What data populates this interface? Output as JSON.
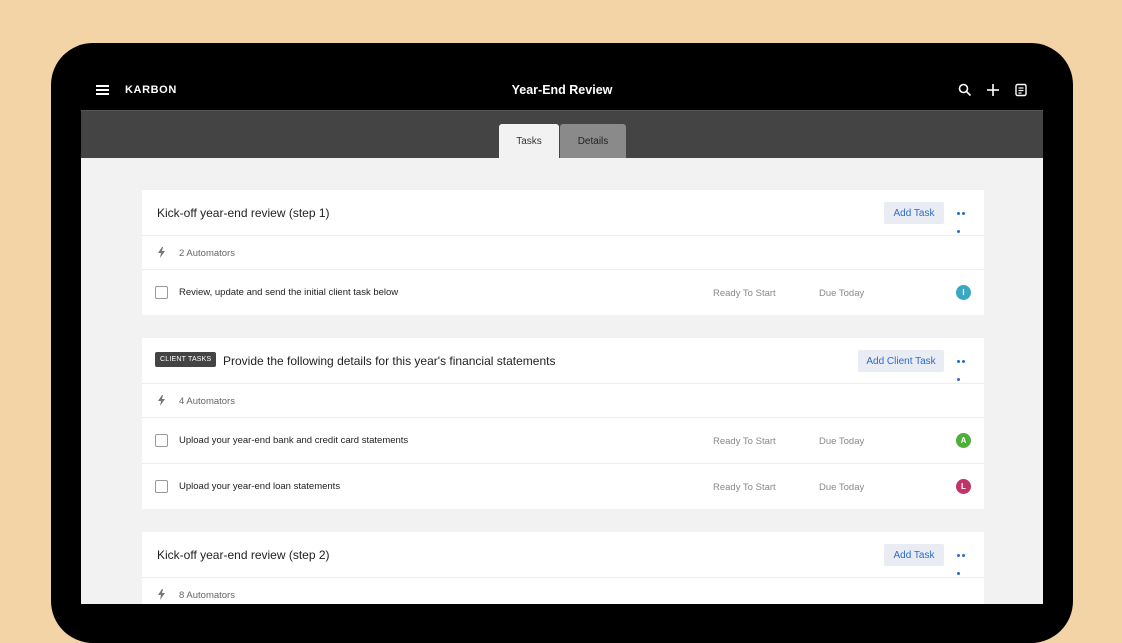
{
  "app": {
    "brand": "KARBON",
    "title": "Year-End Review"
  },
  "tabs": [
    {
      "label": "Tasks"
    },
    {
      "label": "Details"
    }
  ],
  "sections": [
    {
      "badge": "",
      "title": "Kick-off year-end review (step 1)",
      "button": "Add Task",
      "automators": "2 Automators",
      "tasks": [
        {
          "text": "Review, update and send the initial client task below",
          "status": "Ready To Start",
          "due": "Due Today",
          "avatar": "I",
          "avatar_color": "#3aa7c4"
        }
      ]
    },
    {
      "badge": "CLIENT TASKS",
      "title": "Provide the following details for this year's financial statements",
      "button": "Add Client Task",
      "automators": "4 Automators",
      "tasks": [
        {
          "text": "Upload your year-end bank and credit card statements",
          "status": "Ready To Start",
          "due": "Due Today",
          "avatar": "A",
          "avatar_color": "#4caf38"
        },
        {
          "text": "Upload your year-end loan statements",
          "status": "Ready To Start",
          "due": "Due Today",
          "avatar": "L",
          "avatar_color": "#c0336b"
        }
      ]
    },
    {
      "badge": "",
      "title": "Kick-off year-end review (step 2)",
      "button": "Add Task",
      "automators": "8 Automators",
      "tasks": []
    }
  ],
  "colors": {
    "accent": "#2d6bc9",
    "background": "#f3d4a6"
  }
}
